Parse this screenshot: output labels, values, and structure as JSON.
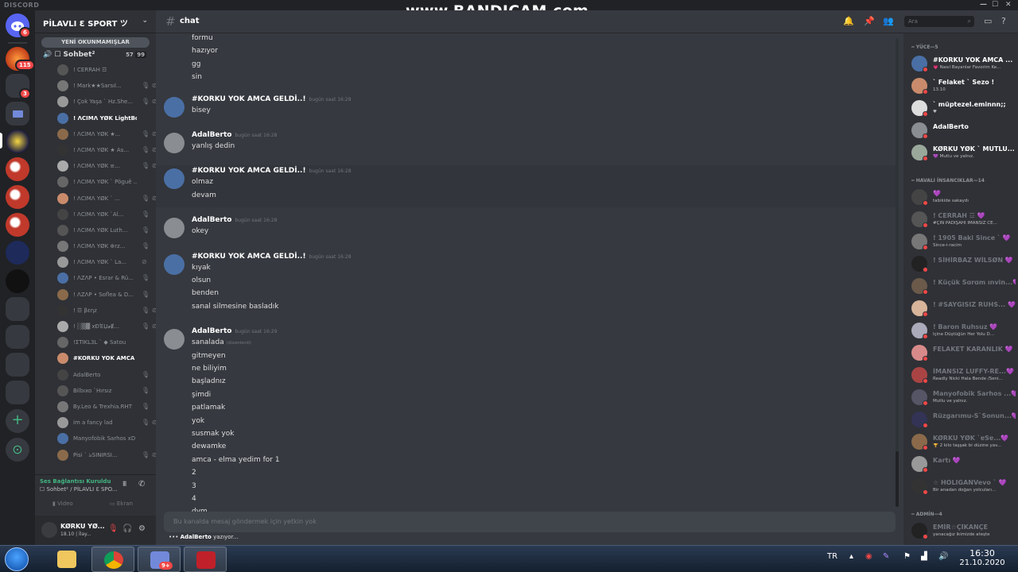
{
  "window": {
    "brand": "DISCORD",
    "minimize": "—",
    "maximize": "☐",
    "close": "✕"
  },
  "watermark": "www.BANDICAM.com",
  "rail": {
    "badge_home": "6",
    "badge_2": "115",
    "badge_3": "3",
    "add": "+",
    "explore": "⊙"
  },
  "sidebar": {
    "server_name": "PİLAVLI Ɛ SPORT ツ",
    "new_unread": "YENİ OKUNMAMIŞLAR",
    "voice_channel": "☐ Sohbet²",
    "voice_count_a": "57",
    "voice_count_b": "99",
    "voice_users": [
      {
        "name": "! CERRAH ☲",
        "icons": ""
      },
      {
        "name": "! Mark★★Sarsıl...",
        "icons": "🎙 ⊘"
      },
      {
        "name": "! Çok Yaşa ` Hz.She...",
        "icons": "🎙 ⊘"
      },
      {
        "name": "! ΛCIMΛ YØK LightBolth...",
        "icons": ""
      },
      {
        "name": "! ΛCIMΛ YØK ★...",
        "icons": "🎙 ⊘"
      },
      {
        "name": "! ΛCIMΛ YØK ★ As...",
        "icons": "🎙 ⊘"
      },
      {
        "name": "! ΛCIMΛ YØK ≡...",
        "icons": "🎙 ⊘"
      },
      {
        "name": "! ΛCIMΛ YØK ` Pöguê ...",
        "icons": ""
      },
      {
        "name": "! ΛCIMΛ YØK ` ...",
        "icons": "🎙 ⊘"
      },
      {
        "name": "! ΛCIMΛ YØK `Al...",
        "icons": "🎙"
      },
      {
        "name": "! ΛCIMΛ YØK Luth...",
        "icons": "🎙"
      },
      {
        "name": "! ΛCIMΛ YØK ⊕rz...",
        "icons": "🎙"
      },
      {
        "name": "! ΛCIMΛ YØK ` La...",
        "icons": "⊘"
      },
      {
        "name": "! ΛZΛP • Esrar & Rü...",
        "icons": "🎙"
      },
      {
        "name": "! ΛZΛP • Soflea & D...",
        "icons": "🎙"
      },
      {
        "name": "! ☲ βεηz",
        "icons": "🎙 ⊘"
      },
      {
        "name": "! ░▒▓ xÐΈЏ҂Ɇ...",
        "icons": "🎙 ⊘"
      },
      {
        "name": "!ΣTIKL3L ` ◆ Satou",
        "icons": ""
      },
      {
        "name": "#KORKU YOK AMCA G...",
        "icons": ""
      },
      {
        "name": "AdalBerto",
        "icons": "🎙"
      },
      {
        "name": "Bilbıxo `Hırsız",
        "icons": "🎙"
      },
      {
        "name": "By.Leo & Trexhia.RHT",
        "icons": "🎙"
      },
      {
        "name": "im a fancy lad",
        "icons": "🎙 ⊘"
      },
      {
        "name": "Manyofobik Sarhos xD",
        "icons": ""
      },
      {
        "name": "Pisi ` ঌSINIRSI...",
        "icons": "🎙 ⊘"
      }
    ],
    "voice_status": "Ses Bağlantısı Kuruldu",
    "voice_sub": "☐ Sohbet² / PİLAVLI Ɛ SPO...",
    "video_label": "Video",
    "screen_label": "Ekran",
    "user_name": "KØRKU YØ...",
    "user_tag": "18.10 | İlay..."
  },
  "chat": {
    "channel": "chat",
    "composer_placeholder": "Bu kanalda mesaj göndermek için yetkin yok",
    "typing_user": "AdalBerto",
    "typing_suffix": "yazıyor...",
    "top_lines": [
      "formu",
      "hazıyor",
      "gg",
      "sin"
    ],
    "groups": [
      {
        "author": "#KORKU YOK AMCA GELDİ..!",
        "time": "bugün saat 16:28",
        "lines": [
          "bisey"
        ],
        "hl": false,
        "av": "#4a6fa5"
      },
      {
        "author": "AdalBerto",
        "time": "bugün saat 16:28",
        "lines": [
          "yanlış dedin"
        ],
        "hl": false,
        "av": "#8a8d91"
      },
      {
        "author": "#KORKU YOK AMCA GELDİ..!",
        "time": "bugün saat 16:28",
        "lines": [
          "olmaz",
          "devam"
        ],
        "hl": true,
        "av": "#4a6fa5"
      },
      {
        "author": "AdalBerto",
        "time": "bugün saat 16:28",
        "lines": [
          "okey"
        ],
        "hl": false,
        "av": "#8a8d91"
      },
      {
        "author": "#KORKU YOK AMCA GELDİ..!",
        "time": "bugün saat 16:28",
        "lines": [
          "kıyak",
          "olsun",
          "benden",
          "sanal silmesine basladık"
        ],
        "hl": false,
        "av": "#4a6fa5"
      },
      {
        "author": "AdalBerto",
        "time": "bugün saat 16:29",
        "lines": [
          "sanalada",
          "gitmeyen",
          "ne biliyim",
          "başladnız",
          "şimdi",
          "patlamak",
          "yok",
          "susmak yok",
          "dewamke",
          "amca - elma yedim for 1",
          "2",
          "3",
          "4",
          "dvm"
        ],
        "hl": false,
        "av": "#8a8d91",
        "edited_line": 0,
        "edited": "(düzenlendi)"
      }
    ]
  },
  "header": {
    "search_placeholder": "Ara"
  },
  "members": {
    "groups": [
      {
        "title": "═ YÜCE—5",
        "items": [
          {
            "name": "#KORKU YOK AMCA ...",
            "status": "💗 Nasıl Bayanlar Favorim Ke...",
            "av": "#4a6fa5"
          },
          {
            "name": "` Felaket ` Sezo !",
            "status": "13.10",
            "av": "#c98b6b"
          },
          {
            "name": "` müptezel.eminnn;;",
            "status": "♥",
            "av": "#ddd"
          },
          {
            "name": "AdalBerto",
            "status": "",
            "av": "#8a8d91"
          },
          {
            "name": "KØRKU YØK ` MUTLU...",
            "status": "💜 Mutlu ve yalnız.",
            "av": "#9aa89b"
          }
        ]
      },
      {
        "title": "═ HAVALI İNSANCIKLAR—14",
        "items": [
          {
            "name": "💜",
            "status": "tabikide sakaydı",
            "av": "#444",
            "dim": true
          },
          {
            "name": "! CERRAH ☲ 💜",
            "status": "#ÇİN PADİŞAHI İMANSIZ CE...",
            "av": "#555",
            "dim": true
          },
          {
            "name": "! 1905 Baki Since ` 💜",
            "status": "Since-i-racim",
            "av": "#777",
            "dim": true
          },
          {
            "name": "! SİHİRBAZ WİLSØN 💜",
            "status": "",
            "av": "#222",
            "dim": true
          },
          {
            "name": "! Küçük Sɑrɑm ınvin...💜",
            "status": "",
            "av": "#6b5a4a",
            "dim": true
          },
          {
            "name": "! #SAYGISIZ RUHS... 💜",
            "status": "",
            "av": "#d7b49a",
            "dim": true
          },
          {
            "name": "! Baron Ruhsuz 💜",
            "status": "İçine Düştüğün Her Yolu D...",
            "av": "#aab",
            "dim": true
          },
          {
            "name": "FELAKET KARANLIK 💜",
            "status": "",
            "av": "#d88a8a",
            "dim": true
          },
          {
            "name": "İMANSIZ LUFFY-RE...💜",
            "status": "Readly Nicki Hala Bende /Seni...",
            "av": "#a44",
            "dim": true
          },
          {
            "name": "Manyofobik Sarhos ...💜",
            "status": "Mutlu ve yalnız.",
            "av": "#556",
            "dim": true
          },
          {
            "name": "Rüzgarımu-S`Sonun...💜",
            "status": "",
            "av": "#335",
            "dim": true
          },
          {
            "name": "KØRKU YØK `ɐSɐ...💜",
            "status": "🏆 2 kilo taşşak bi düzine yav...",
            "av": "#8a6a4a",
            "dim": true
          },
          {
            "name": "Kartı 💜",
            "status": "",
            "av": "#999",
            "dim": true
          },
          {
            "name": "☆ HOLIGANVevo ` 💜",
            "status": "Bir anadan doğan yolcuları...",
            "av": "#333",
            "dim": true
          }
        ]
      },
      {
        "title": "═ ADMİN—4",
        "items": [
          {
            "name": "EMİR☆ÇİKANÇE",
            "status": "yanacağız ikimizde ateşte",
            "av": "#222",
            "dim": true
          }
        ]
      }
    ]
  },
  "taskbar": {
    "lang": "TR",
    "discord_badge": "9+",
    "time": "16:30",
    "date": "21.10.2020"
  }
}
